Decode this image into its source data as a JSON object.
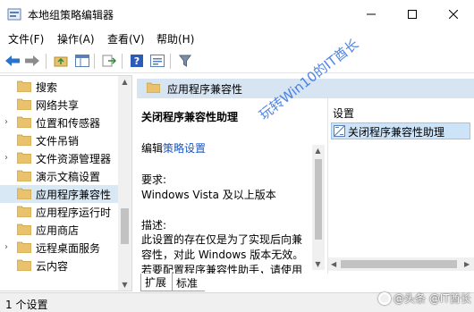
{
  "window": {
    "title": "本地组策略编辑器"
  },
  "menu": {
    "items": [
      "文件(F)",
      "操作(A)",
      "查看(V)",
      "帮助(H)"
    ]
  },
  "toolbar": {
    "buttons": [
      "back-arrow-icon",
      "forward-arrow-icon",
      "up-folder-icon",
      "show-hide-tree-icon",
      "export-list-icon",
      "help-icon",
      "properties-icon",
      "filter-icon"
    ]
  },
  "tree": {
    "items": [
      {
        "label": "搜索",
        "expandable": false,
        "selected": false
      },
      {
        "label": "网络共享",
        "expandable": false,
        "selected": false
      },
      {
        "label": "位置和传感器",
        "expandable": true,
        "selected": false
      },
      {
        "label": "文件吊销",
        "expandable": false,
        "selected": false
      },
      {
        "label": "文件资源管理器",
        "expandable": true,
        "selected": false
      },
      {
        "label": "演示文稿设置",
        "expandable": false,
        "selected": false
      },
      {
        "label": "应用程序兼容性",
        "expandable": false,
        "selected": true
      },
      {
        "label": "应用程序运行时",
        "expandable": false,
        "selected": false
      },
      {
        "label": "应用商店",
        "expandable": false,
        "selected": false
      },
      {
        "label": "远程桌面服务",
        "expandable": true,
        "selected": false
      },
      {
        "label": "云内容",
        "expandable": false,
        "selected": false
      }
    ]
  },
  "details": {
    "header": "应用程序兼容性",
    "policy_title": "关闭程序兼容性助理",
    "edit_prefix": "编辑",
    "edit_link": "策略设置",
    "requirements_label": "要求:",
    "requirements_value": "Windows Vista 及以上版本",
    "description_label": "描述:",
    "description_text": "此设置的存在仅是为了实现后向兼容性，对此 Windows 版本无效。若要配置程序兼容性助手，请使用"
  },
  "list": {
    "column_header": "设置",
    "rows": [
      "关闭程序兼容性助理"
    ]
  },
  "tabs": [
    "扩展",
    "标准"
  ],
  "status": {
    "text": "1 个设置"
  },
  "overlays": {
    "watermark": "玩转Win10的IT酋长",
    "brand": "@头条 @IT酋长"
  },
  "colors": {
    "selection": "#cde3f7",
    "header_band": "#d7e4f2",
    "link": "#1a56c5",
    "folder": "#e8c26c"
  }
}
